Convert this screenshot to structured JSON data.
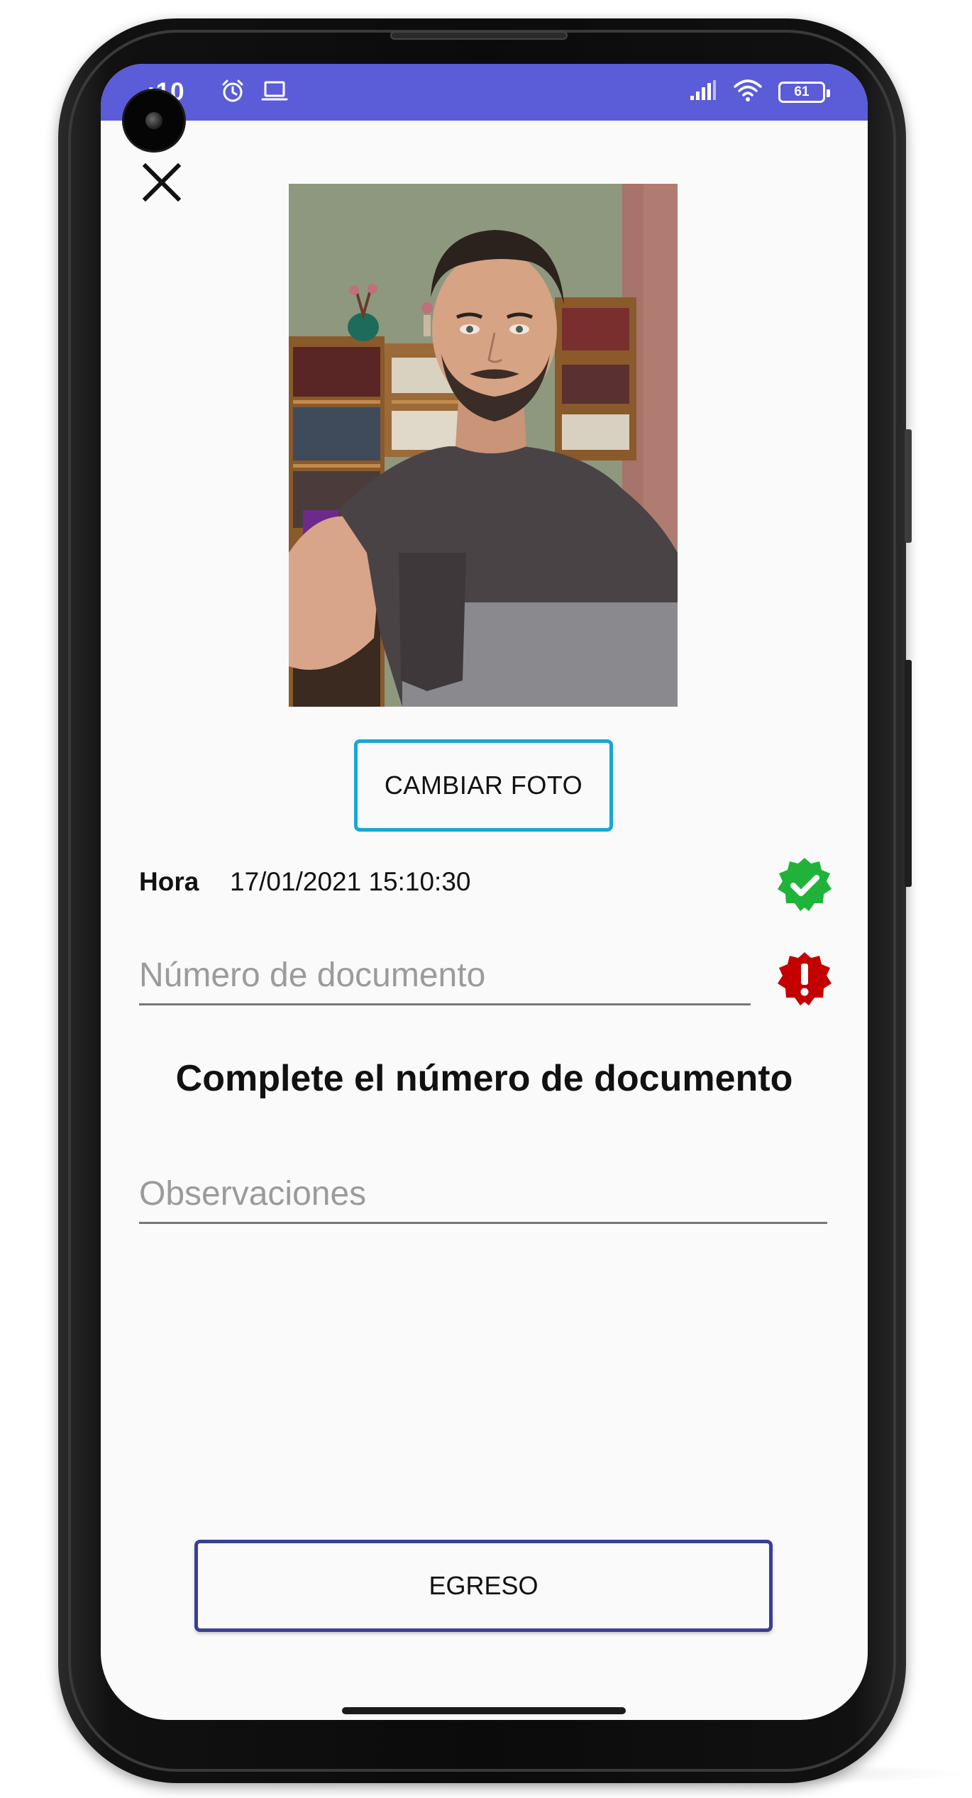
{
  "status_bar": {
    "time": ":10",
    "battery_level": "61",
    "color": "#5b5cd8",
    "icons_left": [
      "alarm-icon",
      "laptop-icon"
    ],
    "icons_right": [
      "signal-icon",
      "wifi-icon",
      "battery-icon"
    ]
  },
  "form": {
    "close_icon": "close-icon",
    "change_photo_label": "CAMBIAR FOTO",
    "time_label": "Hora",
    "time_value": "17/01/2021 15:10:30",
    "time_status": "ok",
    "document_placeholder": "Número de documento",
    "document_status": "error",
    "error_message": "Complete el número de documento",
    "observations_placeholder": "Observaciones",
    "submit_label": "EGRESO"
  },
  "colors": {
    "accent_button_border": "#17a7d6",
    "submit_button_border": "#3a3f94",
    "ok_badge": "#1fb33a",
    "error_badge": "#c40000"
  }
}
